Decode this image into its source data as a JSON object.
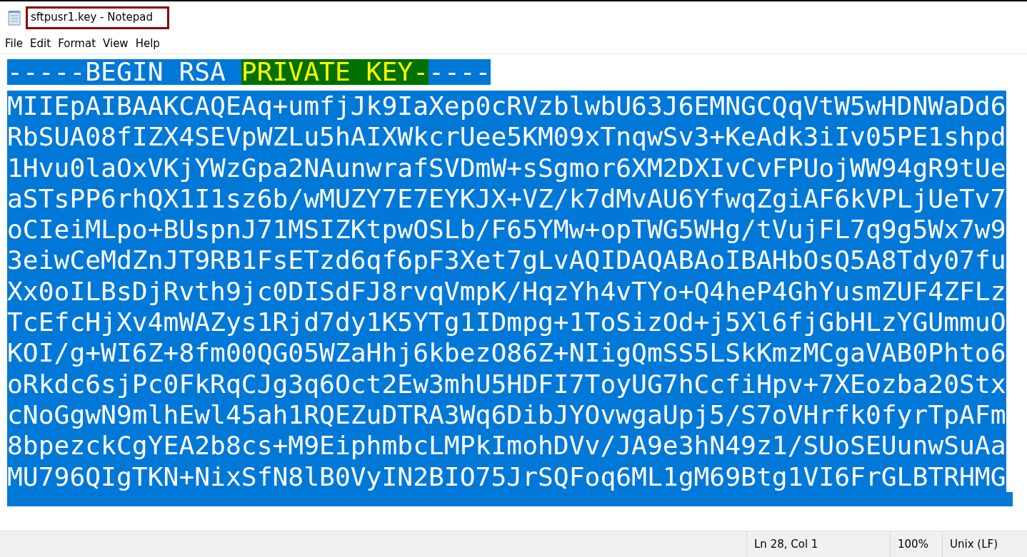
{
  "window": {
    "title": "sftpusr1.key - Notepad"
  },
  "menu": [
    "File",
    "Edit",
    "Format",
    "View",
    "Help"
  ],
  "editor": {
    "selected": true,
    "header": [
      {
        "text": "-----BEGIN RSA ",
        "highlighted": false
      },
      {
        "text": "PRIVATE KEY-",
        "highlighted": true
      },
      {
        "text": "----",
        "highlighted": false
      }
    ],
    "lines": [
      "MIIEpAIBAAKCAQEAq+umfjJk9IaXep0cRVzblwbU63J6EMNGCQqVtW5wHDNWaDd6",
      "RbSUA08fIZX4SEVpWZLu5hAIXWkcrUee5KM09xTnqwSv3+KeAdk3iIv05PE1shpd",
      "1Hvu0laOxVKjYWzGpa2NAunwrafSVDmW+sSgmor6XM2DXIvCvFPUojWW94gR9tUe",
      "aSTsPP6rhQX1I1sz6b/wMUZY7E7EYKJX+VZ/k7dMvAU6YfwqZgiAF6kVPLjUeTv7",
      "oCIeiMLpo+BUspnJ71MSIZKtpwOSLb/F65YMw+opTWG5WHg/tVujFL7q9g5Wx7w9",
      "3eiwCeMdZnJT9RB1FsETzd6qf6pF3Xet7gLvAQIDAQABAoIBAHbOsQ5A8Tdy07fu",
      "Xx0oILBsDjRvth9jc0DISdFJ8rvqVmpK/HqzYh4vTYo+Q4heP4GhYusmZUF4ZFLz",
      "TcEfcHjXv4mWAZys1Rjd7dy1K5YTg1IDmpg+1ToSizOd+j5Xl6fjGbHLzYGUmmuO",
      "KOI/g+WI6Z+8fm00QG05WZaHhj6kbezO86Z+NIigQmSS5LSkKmzMCgaVAB0Phto6",
      "oRkdc6sjPc0FkRqCJg3q6Oct2Ew3mhU5HDFI7ToyUG7hCcfiHpv+7XEozba20Stx",
      "cNoGgwN9mlhEwl45ah1RQEZuDTRA3Wq6DibJYOvwgaUpj5/S7oVHrfk0fyrTpAFm",
      "8bpezckCgYEA2b8cs+M9EiphmbcLMPkImohDVv/JA9e3hN49z1/SUoSEUunwSuAa",
      "MU796QIgTKN+NixSfN8lB0VyIN2BIO75JrSQFoq6ML1gM69Btg1VI6FrGLBTRHMG"
    ]
  },
  "status_bar": {
    "position": "Ln 28, Col 1",
    "zoom": "100%",
    "line_ending": "Unix (LF)"
  }
}
